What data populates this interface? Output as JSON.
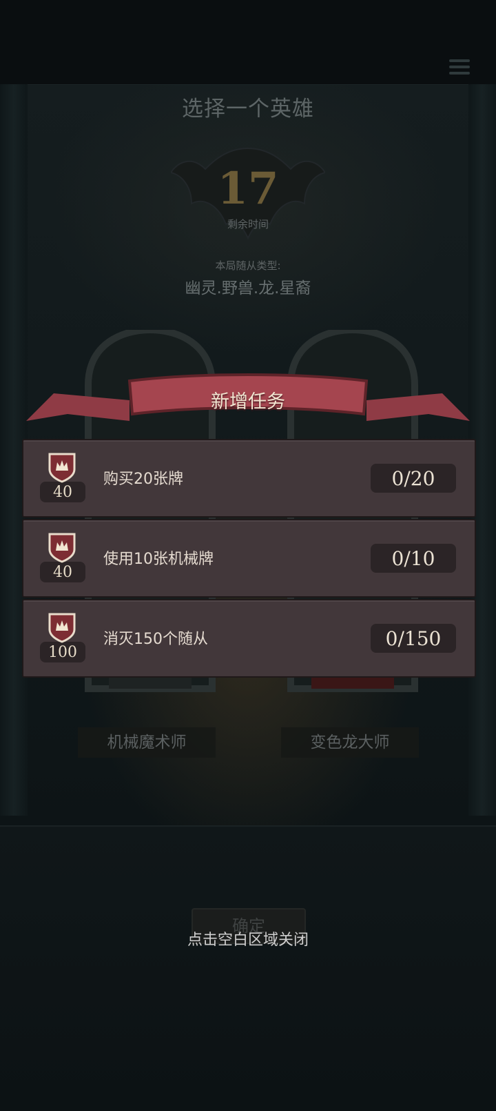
{
  "header": {
    "title": "选择一个英雄"
  },
  "timer": {
    "value": "17",
    "label": "剩余时间"
  },
  "minions": {
    "label": "本局随从类型:",
    "types": "幽灵.野兽.龙.星裔"
  },
  "heroes": [
    {
      "name": "机械魔术师"
    },
    {
      "name": "变色龙大师"
    }
  ],
  "confirm": {
    "label": "确定"
  },
  "popup": {
    "title": "新增任务",
    "tasks": [
      {
        "reward": "40",
        "description": "购买20张牌",
        "progress": "0/20"
      },
      {
        "reward": "40",
        "description": "使用10张机械牌",
        "progress": "0/10"
      },
      {
        "reward": "100",
        "description": "消灭150个随从",
        "progress": "0/150"
      }
    ],
    "close_hint": "点击空白区域关闭"
  },
  "colors": {
    "ribbon": "#a5454f",
    "task_panel": "#42373a",
    "gold": "#6b5b36"
  },
  "icons": [
    "menu-icon",
    "crown-shield-icon"
  ]
}
